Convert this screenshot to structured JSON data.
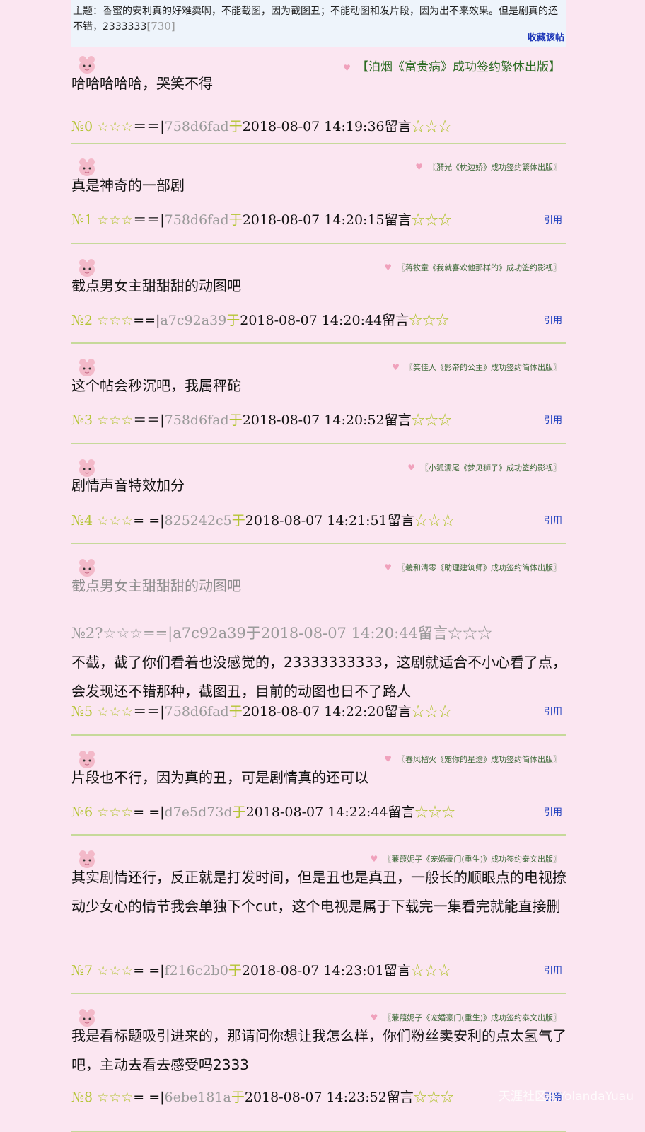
{
  "topic": {
    "text": "主题：香蜜的安利真的好难卖啊，不能截图，因为截图丑；不能动图和发片段，因为出不来效果。但是剧真的还不错，2333333",
    "count": "[730]",
    "favorite_label": "收藏该帖"
  },
  "posts": [
    {
      "sig": "【泊烟《富贵病》成功签约繁体出版】",
      "content": "哈哈哈哈哈，哭笑不得",
      "num": "№0",
      "stars1": "☆☆☆",
      "sep": "＝＝|",
      "uid": "758d6fad",
      "yu": "于",
      "time": "2018-08-07 14:19:36留言",
      "stars2": "☆☆☆",
      "ref": ""
    },
    {
      "sig": "〖漪光《枕边娇》成功签约繁体出版〗",
      "content": "真是神奇的一部剧",
      "num": "№1",
      "stars1": "☆☆☆",
      "sep": "＝＝|",
      "uid": "758d6fad",
      "yu": "于",
      "time": "2018-08-07 14:20:15留言",
      "stars2": "☆☆☆",
      "ref": "引用"
    },
    {
      "sig": "〖蒋牧童《我就喜欢他那样的》成功签约影视〗",
      "content": "截点男女主甜甜甜的动图吧",
      "num": "№2",
      "stars1": "☆☆☆",
      "sep": "==|",
      "uid": "a7c92a39",
      "yu": "于",
      "time": "2018-08-07 14:20:44留言",
      "stars2": "☆☆☆",
      "ref": "引用"
    },
    {
      "sig": "〖笑佳人《影帝的公主》成功签约简体出版〗",
      "content": "这个帖会秒沉吧，我属秤砣",
      "num": "№3",
      "stars1": "☆☆☆",
      "sep": "＝＝|",
      "uid": "758d6fad",
      "yu": "于",
      "time": "2018-08-07 14:20:52留言",
      "stars2": "☆☆☆",
      "ref": "引用"
    },
    {
      "sig": "〖小狐濡尾《梦见狮子》成功签约影视〗",
      "content": "剧情声音特效加分",
      "num": "№4",
      "stars1": "☆☆☆",
      "sep": "= =|",
      "uid": "825242c5",
      "yu": "于",
      "time": "2018-08-07 14:21:51留言",
      "stars2": "☆☆☆",
      "ref": "引用"
    },
    {
      "sig": "〖羲和清零《助理建筑师》成功签约简体出版〗",
      "quote_content": "截点男女主甜甜甜的动图吧",
      "quote_meta": "№2?☆☆☆==|a7c92a39于2018-08-07 14:20:44留言☆☆☆",
      "content": "不截，截了你们看着也没感觉的，23333333333，这剧就适合不小心看了点，会发现还不错那种，截图丑，目前的动图也日不了路人",
      "num": "№5",
      "stars1": "☆☆☆",
      "sep": "＝＝|",
      "uid": "758d6fad",
      "yu": "于",
      "time": "2018-08-07 14:22:20留言",
      "stars2": "☆☆☆",
      "ref": "引用"
    },
    {
      "sig": "〖春风榴火《宠你的星途》成功签约简体出版〗",
      "content": "片段也不行，因为真的丑，可是剧情真的还可以",
      "num": "№6",
      "stars1": "☆☆☆",
      "sep": "= =|",
      "uid": "d7e5d73d",
      "yu": "于",
      "time": "2018-08-07 14:22:44留言",
      "stars2": "☆☆☆",
      "ref": "引用"
    },
    {
      "sig": "〖蒹葭妮子《宠婚豪门(重生)》成功签约泰文出版〗",
      "content": "其实剧情还行，反正就是打发时间，但是丑也是真丑，一般长的顺眼点的电视撩动少女心的情节我会单独下个cut，这个电视是属于下载完一集看完就能直接删",
      "num": "№7",
      "stars1": "☆☆☆",
      "sep": "= =|",
      "uid": "f216c2b0",
      "yu": "于",
      "time": "2018-08-07 14:23:01留言",
      "stars2": "☆☆☆",
      "ref": "引用"
    },
    {
      "sig": "〖蒹葭妮子《宠婚豪门(重生)》成功签约泰文出版〗",
      "content": "我是看标题吸引进来的，那请问你想让我怎么样，你们粉丝卖安利的点太氢气了吧，主动去看去感受吗2333",
      "num": "№8",
      "stars1": "☆☆☆",
      "sep": "= =|",
      "uid": "6ebe181a",
      "yu": "于",
      "time": "2018-08-07 14:23:52留言",
      "stars2": "☆☆☆",
      "ref": "引用"
    }
  ],
  "watermark": "天涯社区@YolandaYuau"
}
